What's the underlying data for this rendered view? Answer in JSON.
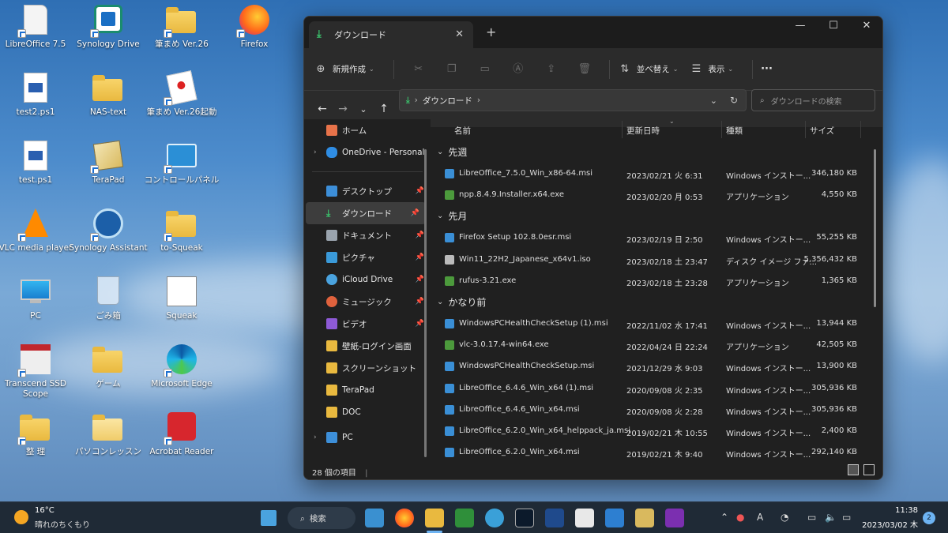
{
  "desktop": {
    "icons": [
      {
        "label": "LibreOffice 7.5"
      },
      {
        "label": "Synology Drive"
      },
      {
        "label": "筆まめ Ver.26"
      },
      {
        "label": "Firefox"
      },
      {
        "label": "test2.ps1"
      },
      {
        "label": "NAS-text"
      },
      {
        "label": "筆まめ Ver.26起動"
      },
      {
        "label": "test.ps1"
      },
      {
        "label": "TeraPad"
      },
      {
        "label": "コントロールパネル"
      },
      {
        "label": "VLC media player"
      },
      {
        "label": "Synology Assistant"
      },
      {
        "label": "to-Squeak"
      },
      {
        "label": "PC"
      },
      {
        "label": "ごみ箱"
      },
      {
        "label": "Squeak"
      },
      {
        "label": "Transcend SSD Scope"
      },
      {
        "label": "ゲーム"
      },
      {
        "label": "Microsoft Edge"
      },
      {
        "label": "整 理"
      },
      {
        "label": "パソコンレッスン"
      },
      {
        "label": "Acrobat Reader"
      }
    ]
  },
  "explorer": {
    "tab_title": "ダウンロード",
    "new_tab": "+",
    "toolbar": {
      "new_label": "新規作成",
      "sort_label": "並べ替え",
      "view_label": "表示",
      "more_label": "···"
    },
    "address": {
      "segment": "ダウンロード"
    },
    "search_placeholder": "ダウンロードの検索",
    "nav_pane": {
      "items": [
        {
          "label": "ホーム",
          "color": "#e8734a"
        },
        {
          "label": "OneDrive - Personal",
          "color": "#2f8de4"
        },
        {
          "label": "デスクトップ",
          "color": "#3d8fd9"
        },
        {
          "label": "ダウンロード",
          "color": "#3bc06b"
        },
        {
          "label": "ドキュメント",
          "color": "#9aa4ae"
        },
        {
          "label": "ピクチャ",
          "color": "#3a9ad9"
        },
        {
          "label": "iCloud Drive",
          "color": "#4aa3df"
        },
        {
          "label": "ミュージック",
          "color": "#e0623d"
        },
        {
          "label": "ビデオ",
          "color": "#8e5ad6"
        },
        {
          "label": "壁紙-ログイン画面",
          "color": "#e9b93f"
        },
        {
          "label": "スクリーンショット",
          "color": "#e9b93f"
        },
        {
          "label": "TeraPad",
          "color": "#e9b93f"
        },
        {
          "label": "DOC",
          "color": "#e9b93f"
        },
        {
          "label": "PC",
          "color": "#3d8fd9"
        }
      ]
    },
    "columns": {
      "name": "名前",
      "date": "更新日時",
      "type": "種類",
      "size": "サイズ"
    },
    "groups": [
      {
        "label": "先週",
        "files": [
          {
            "name": "LibreOffice_7.5.0_Win_x86-64.msi",
            "date": "2023/02/21 火 6:31",
            "type": "Windows インストー...",
            "size": "346,180 KB"
          },
          {
            "name": "npp.8.4.9.Installer.x64.exe",
            "date": "2023/02/20 月 0:53",
            "type": "アプリケーション",
            "size": "4,550 KB"
          }
        ]
      },
      {
        "label": "先月",
        "files": [
          {
            "name": "Firefox Setup 102.8.0esr.msi",
            "date": "2023/02/19 日 2:50",
            "type": "Windows インストー...",
            "size": "55,255 KB"
          },
          {
            "name": "Win11_22H2_Japanese_x64v1.iso",
            "date": "2023/02/18 土 23:47",
            "type": "ディスク イメージ ファ...",
            "size": "5,356,432 KB"
          },
          {
            "name": "rufus-3.21.exe",
            "date": "2023/02/18 土 23:28",
            "type": "アプリケーション",
            "size": "1,365 KB"
          }
        ]
      },
      {
        "label": "かなり前",
        "files": [
          {
            "name": "WindowsPCHealthCheckSetup (1).msi",
            "date": "2022/11/02 水 17:41",
            "type": "Windows インストー...",
            "size": "13,944 KB"
          },
          {
            "name": "vlc-3.0.17.4-win64.exe",
            "date": "2022/04/24 日 22:24",
            "type": "アプリケーション",
            "size": "42,505 KB"
          },
          {
            "name": "WindowsPCHealthCheckSetup.msi",
            "date": "2021/12/29 水 9:03",
            "type": "Windows インストー...",
            "size": "13,900 KB"
          },
          {
            "name": "LibreOffice_6.4.6_Win_x64 (1).msi",
            "date": "2020/09/08 火 2:35",
            "type": "Windows インストー...",
            "size": "305,936 KB"
          },
          {
            "name": "LibreOffice_6.4.6_Win_x64.msi",
            "date": "2020/09/08 火 2:28",
            "type": "Windows インストー...",
            "size": "305,936 KB"
          },
          {
            "name": "LibreOffice_6.2.0_Win_x64_helppack_ja.msi",
            "date": "2019/02/21 木 10:55",
            "type": "Windows インストー...",
            "size": "2,400 KB"
          },
          {
            "name": "LibreOffice_6.2.0_Win_x64.msi",
            "date": "2019/02/21 木 9:40",
            "type": "Windows インストー...",
            "size": "292,140 KB"
          }
        ]
      }
    ],
    "status_count": "28 個の項目"
  },
  "taskbar": {
    "weather_temp": "16°C",
    "weather_desc": "晴れのちくもり",
    "search_label": "検索",
    "time": "11:38",
    "date": "2023/03/02 木",
    "notification_count": "2"
  }
}
